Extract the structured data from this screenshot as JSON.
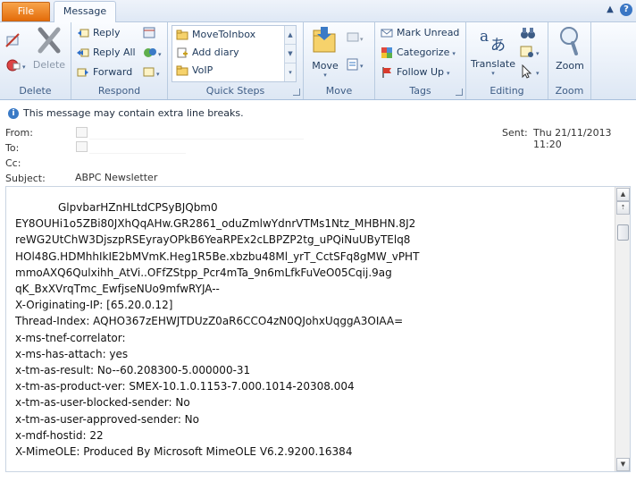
{
  "tabs": {
    "file": "File",
    "message": "Message"
  },
  "ribbon": {
    "delete_group": {
      "label": "Delete",
      "delete_btn": "Delete"
    },
    "respond_group": {
      "label": "Respond",
      "reply": "Reply",
      "reply_all": "Reply All",
      "forward": "Forward"
    },
    "quick_steps": {
      "label": "Quick Steps",
      "items": [
        "MoveToInbox",
        "Add diary",
        "VoIP"
      ]
    },
    "move_group": {
      "label": "Move",
      "move": "Move"
    },
    "tags_group": {
      "label": "Tags",
      "mark_unread": "Mark Unread",
      "categorize": "Categorize",
      "follow_up": "Follow Up"
    },
    "editing_group": {
      "label": "Editing",
      "translate": "Translate"
    },
    "zoom_group": {
      "label": "Zoom",
      "zoom": "Zoom"
    }
  },
  "infobar": {
    "text": "This message may contain extra line breaks."
  },
  "header": {
    "from_label": "From:",
    "to_label": "To:",
    "cc_label": "Cc:",
    "subject_label": "Subject:",
    "subject_value": "ABPC Newsletter",
    "sent_label": "Sent:",
    "sent_value": "Thu 21/11/2013 11:20"
  },
  "body": {
    "lines": [
      "GlpvbarHZnHLtdCPSyBJQbm0",
      "EY8OUHi1o5ZBi80JXhQqAHw.GR2861_oduZmlwYdnrVTMs1Ntz_MHBHN.8J2",
      "reWG2UtChW3DjszpRSEyrayOPkB6YeaRPEx2cLBPZP2tg_uPQiNuUByTElq8",
      "HOl48G.HDMhhIkIE2bMVmK.Heg1R5Be.xbzbu48Ml_yrT_CctSFq8gMW_vPHT",
      "mmoAXQ6Qulxihh_AtVi..OFfZStpp_Pcr4mTa_9n6mLfkFuVeO05Cqij.9ag",
      "qK_BxXVrqTmc_EwfjseNUo9mfwRYJA--",
      "X-Originating-IP: [65.20.0.12]",
      "Thread-Index: AQHO367zEHWJTDUzZ0aR6CCO4zN0QJohxUqggA3OIAA=",
      "x-ms-tnef-correlator:",
      "x-ms-has-attach: yes",
      "x-tm-as-result: No--60.208300-5.000000-31",
      "x-tm-as-product-ver: SMEX-10.1.0.1153-7.000.1014-20308.004",
      "x-tm-as-user-blocked-sender: No",
      "x-tm-as-user-approved-sender: No",
      "x-mdf-hostid: 22",
      "X-MimeOLE: Produced By Microsoft MimeOLE V6.2.9200.16384"
    ]
  }
}
